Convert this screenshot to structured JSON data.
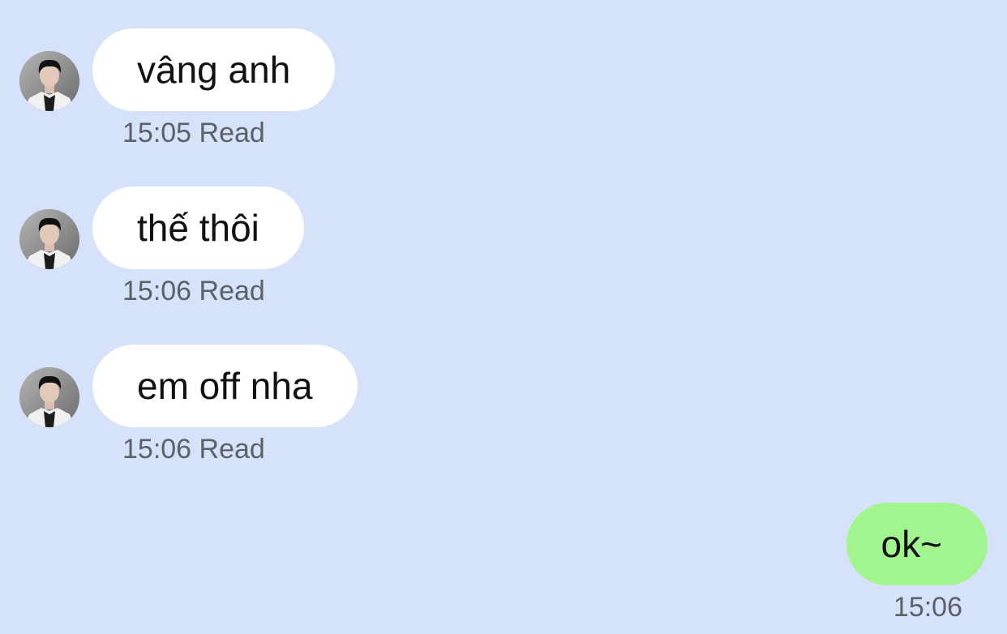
{
  "messages_in": [
    {
      "text": "vâng anh",
      "time": "15:05",
      "status": "Read"
    },
    {
      "text": "thế thôi",
      "time": "15:06",
      "status": "Read"
    },
    {
      "text": "em off nha",
      "time": "15:06",
      "status": "Read"
    }
  ],
  "messages_out": [
    {
      "text": "ok~",
      "time": "15:06"
    }
  ],
  "colors": {
    "background": "#d6e2fa",
    "incoming_bubble": "#ffffff",
    "outgoing_bubble": "#a2f48e",
    "meta_text": "#5c6068"
  },
  "icons": {
    "avatar": "contact-avatar-icon"
  }
}
